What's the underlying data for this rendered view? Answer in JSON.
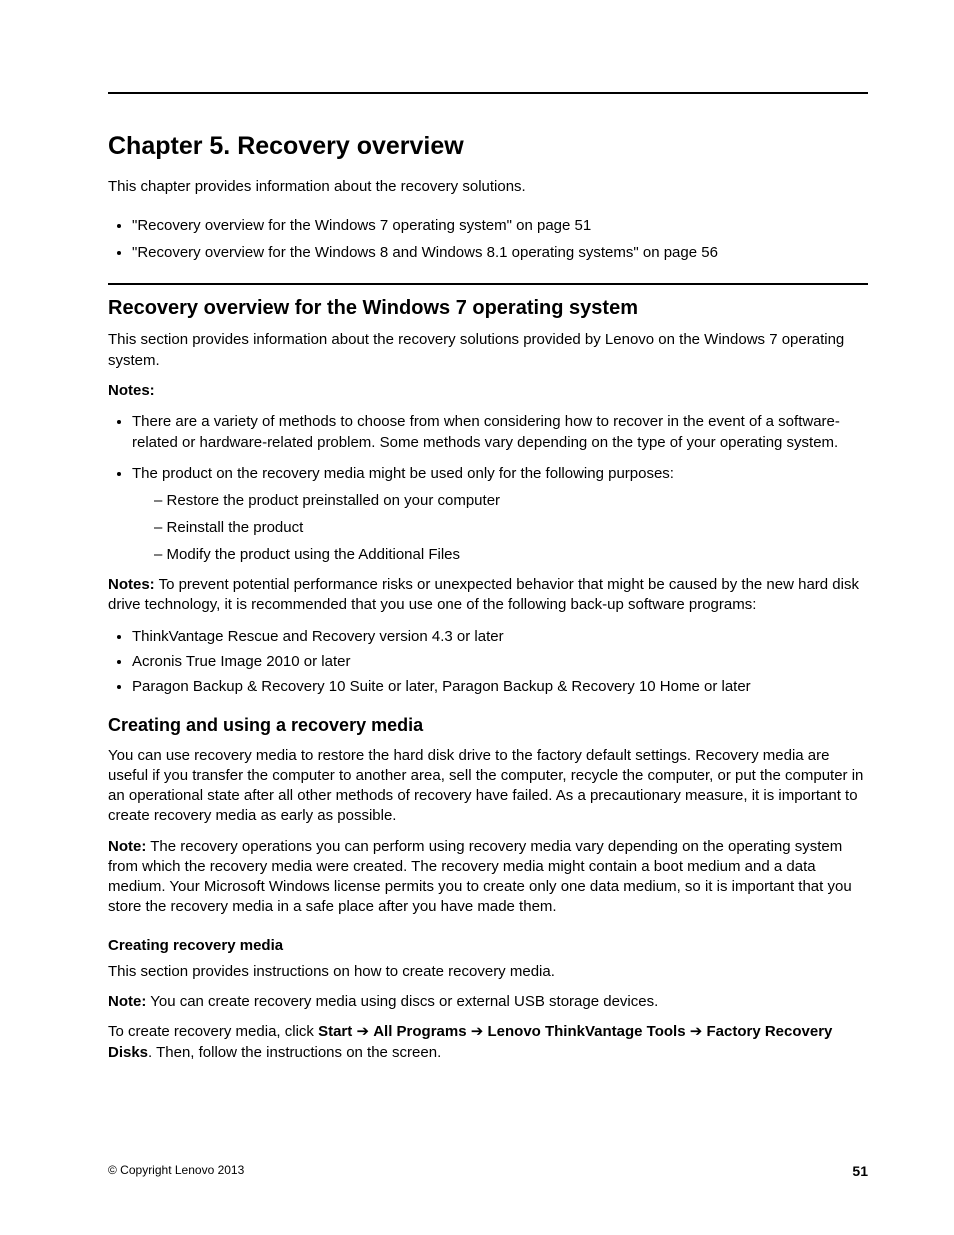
{
  "chapterTitle": "Chapter 5.   Recovery overview",
  "intro": "This chapter provides information about the recovery solutions.",
  "tocItems": [
    "\"Recovery overview for the Windows 7 operating system\" on page 51",
    "\"Recovery overview for the Windows 8 and Windows 8.1 operating systems\" on page 56"
  ],
  "section1": {
    "title": "Recovery overview for the Windows 7 operating system",
    "para": "This section provides information about the recovery solutions provided by Lenovo on the Windows 7 operating system.",
    "notesLabel": "Notes:",
    "notesItems": [
      "There are a variety of methods to choose from when considering how to recover in the event of a software-related or hardware-related problem. Some methods vary depending on the type of your operating system.",
      "The product on the recovery media might be used only for the following purposes:"
    ],
    "subItems": [
      "Restore the product preinstalled on your computer",
      "Reinstall the product",
      "Modify the product using the Additional Files"
    ],
    "notes2Label": "Notes:",
    "notes2Text": " To prevent potential performance risks or unexpected behavior that might be caused by the new hard disk drive technology, it is recommended that you use one of the following back-up software programs:",
    "backupItems": [
      "ThinkVantage Rescue and Recovery version 4.3 or later",
      "Acronis True Image 2010 or later",
      "Paragon Backup & Recovery 10 Suite or later, Paragon Backup & Recovery 10 Home or later"
    ]
  },
  "section2": {
    "title": "Creating and using a recovery media",
    "para1": "You can use recovery media to restore the hard disk drive to the factory default settings. Recovery media are useful if you transfer the computer to another area, sell the computer, recycle the computer, or put the computer in an operational state after all other methods of recovery have failed. As a precautionary measure, it is important to create recovery media as early as possible.",
    "noteLabel": "Note:",
    "noteText": " The recovery operations you can perform using recovery media vary depending on the operating system from which the recovery media were created. The recovery media might contain a boot medium and a data medium. Your Microsoft Windows license permits you to create only one data medium, so it is important that you store the recovery media in a safe place after you have made them.",
    "subHeading": "Creating recovery media",
    "para2": "This section provides instructions on how to create recovery media.",
    "note2Label": "Note:",
    "note2Text": " You can create recovery media using discs or external USB storage devices.",
    "createPrefix": "To create recovery media, click ",
    "createPath": [
      "Start",
      "All Programs",
      "Lenovo ThinkVantage Tools",
      "Factory Recovery Disks"
    ],
    "createSuffix": ". Then, follow the instructions on the screen."
  },
  "footer": {
    "copyright": "© Copyright Lenovo 2013",
    "page": "51"
  }
}
